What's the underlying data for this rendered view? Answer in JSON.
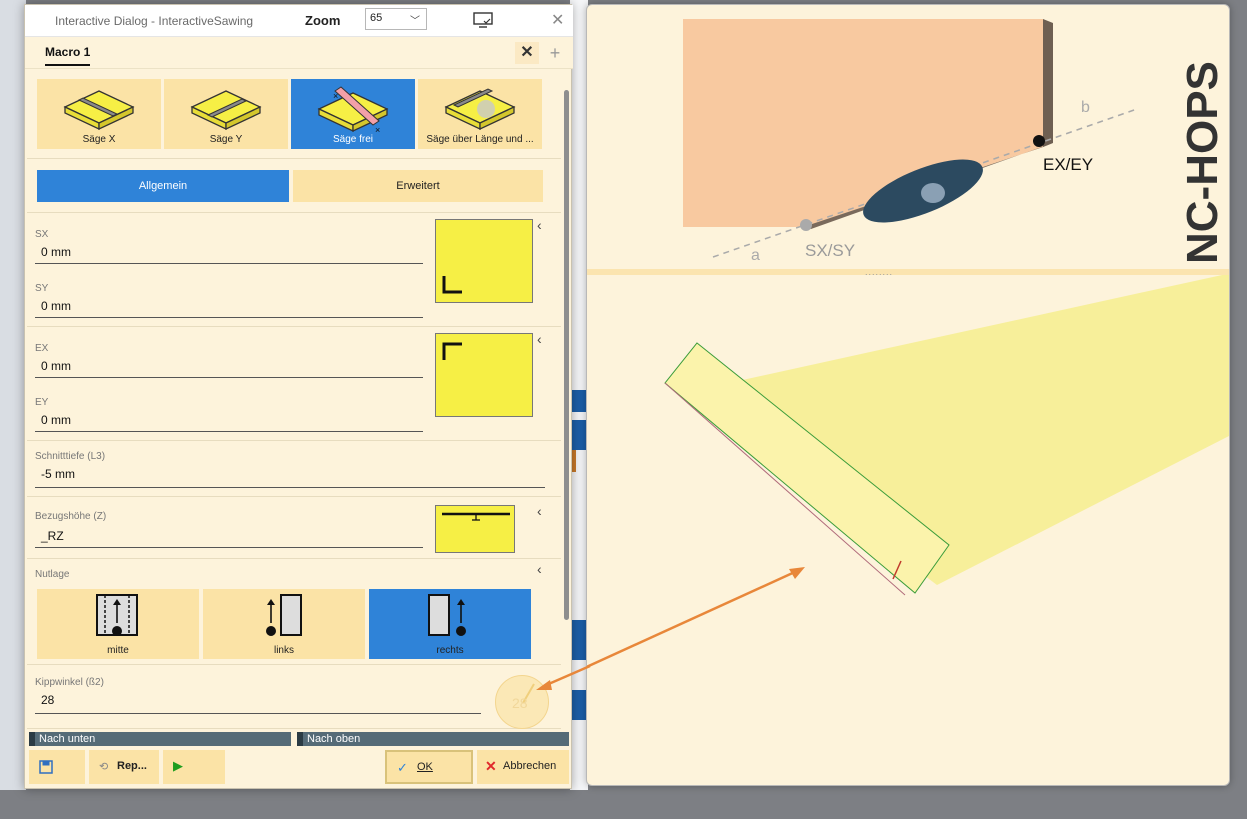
{
  "window": {
    "title": "Interactive Dialog - InteractiveSawing",
    "zoom_label": "Zoom",
    "zoom_value": "65",
    "close_glyph": "✕"
  },
  "tabs": {
    "active": "Macro 1",
    "close_glyph": "✕",
    "add_glyph": "+"
  },
  "tools": [
    {
      "label": "Säge X",
      "icon": "saw-x-icon"
    },
    {
      "label": "Säge Y",
      "icon": "saw-y-icon"
    },
    {
      "label": "Säge frei",
      "icon": "saw-free-icon",
      "selected": true
    },
    {
      "label": "Säge über Länge und ...",
      "icon": "saw-length-icon"
    }
  ],
  "segments": {
    "general": "Allgemein",
    "advanced": "Erweitert"
  },
  "fields": {
    "sx_label": "SX",
    "sx_value": "0 mm",
    "sy_label": "SY",
    "sy_value": "0 mm",
    "ex_label": "EX",
    "ex_value": "0 mm",
    "ey_label": "EY",
    "ey_value": "0 mm",
    "depth_label": "Schnitttiefe (L3)",
    "depth_value": "-5 mm",
    "ref_label": "Bezugshöhe (Z)",
    "ref_value": "_RZ",
    "groove_label": "Nutlage",
    "tilt_label": "Kippwinkel (ß2)",
    "tilt_value": "28"
  },
  "groove_options": [
    {
      "label": "mitte"
    },
    {
      "label": "links"
    },
    {
      "label": "rechts",
      "selected": true
    }
  ],
  "angle_indicator": "28",
  "nav": {
    "down": "Nach unten",
    "up": "Nach oben"
  },
  "bottom": {
    "rep_label": "Rep...",
    "ok_label": "OK",
    "cancel_label": "Abbrechen"
  },
  "viewport": {
    "brand": "NC-HOPS",
    "start_label": "SX/SY",
    "end_label": "EX/EY",
    "axis_a": "a",
    "axis_b": "b",
    "divider_dots": "........"
  },
  "colors": {
    "accent": "#2f83d8",
    "button_bg": "#fbe3a6",
    "panel_bg": "#fdf3db",
    "preview_yellow": "#f6ef45",
    "board": "#f8c9a0",
    "arrow": "#e8873a"
  }
}
